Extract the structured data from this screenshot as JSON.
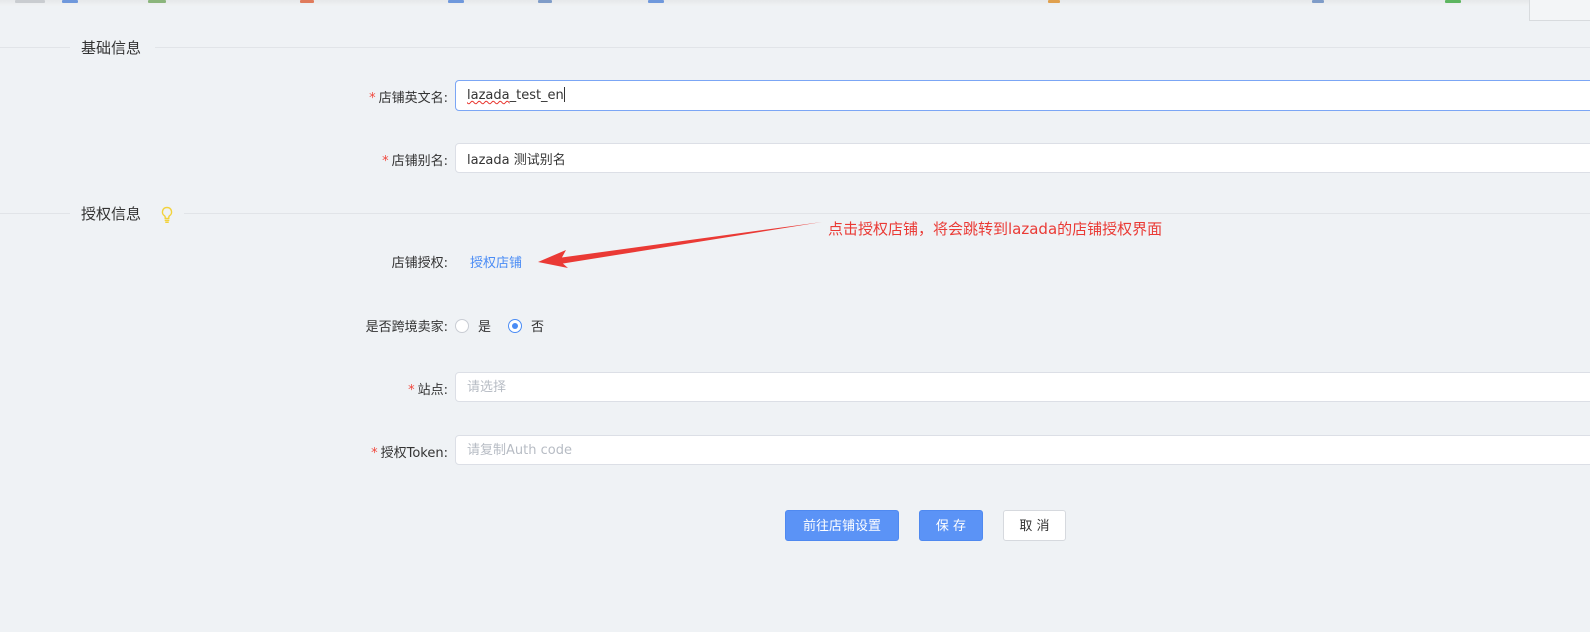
{
  "sections": {
    "basic_info": {
      "title": "基础信息"
    },
    "auth_info": {
      "title": "授权信息"
    }
  },
  "fields": {
    "shop_en_name": {
      "label": "店铺英文名:",
      "required_mark": "*",
      "value_misspelled": "lazada",
      "value_rest": "_test_en"
    },
    "shop_alias": {
      "label": "店铺别名:",
      "required_mark": "*",
      "value": "lazada 测试别名"
    },
    "shop_auth": {
      "label": "店铺授权:",
      "link_text": "授权店铺"
    },
    "cross_border": {
      "label": "是否跨境卖家:",
      "options": [
        {
          "label": "是",
          "checked": false
        },
        {
          "label": "否",
          "checked": true
        }
      ]
    },
    "site": {
      "label": "站点:",
      "required_mark": "*",
      "placeholder": "请选择"
    },
    "auth_token": {
      "label": "授权Token:",
      "required_mark": "*",
      "placeholder": "请复制Auth code"
    }
  },
  "buttons": {
    "goto_settings": "前往店铺设置",
    "save": "保 存",
    "cancel": "取 消"
  },
  "annotation": {
    "text": "点击授权店铺，将会跳转到lazada的店铺授权界面",
    "color": "#ea3a35"
  },
  "colors": {
    "primary": "#5b93f6",
    "link": "#4a8cf5",
    "required": "#f0463c",
    "background": "#eff2f5",
    "hint_icon": "#f5d54a"
  },
  "icons": {
    "hint": "lightbulb-icon"
  }
}
